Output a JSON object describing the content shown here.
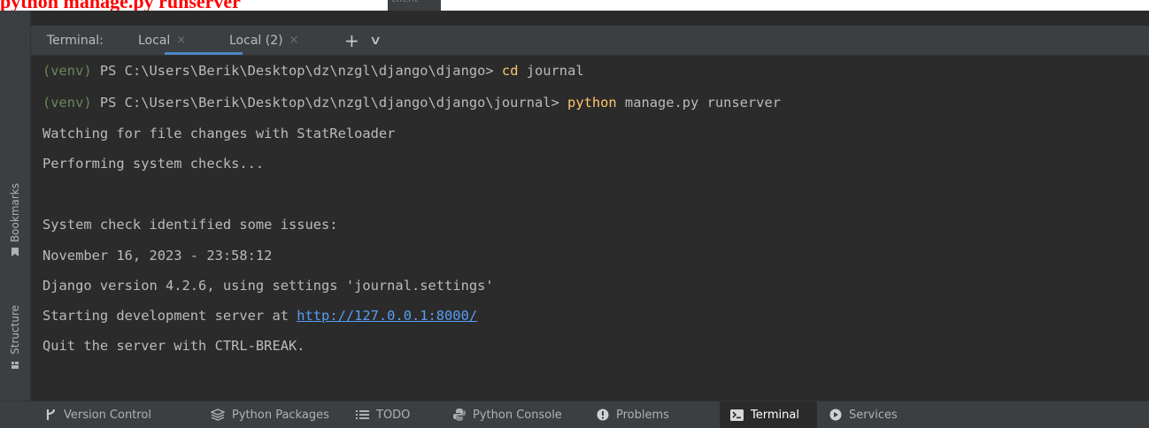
{
  "caption": {
    "text": "python manage.py runserver"
  },
  "top_ghost": {
    "text": "client"
  },
  "left_strip": {
    "bookmarks_label": "Bookmarks",
    "structure_label": "Structure"
  },
  "terminal_header": {
    "title": "Terminal:",
    "tabs": [
      {
        "label": "Local",
        "close": "×"
      },
      {
        "label": "Local (2)",
        "close": "×"
      }
    ],
    "add_symbol": "+",
    "dropdown_symbol": "∨"
  },
  "terminal": {
    "lines": [
      {
        "venv": "(venv)",
        "prompt": " PS C:\\Users\\Berik\\Desktop\\dz\\nzgl\\django\\django> ",
        "cmd": "cd",
        "args": " journal"
      },
      {
        "venv": "(venv)",
        "prompt": " PS C:\\Users\\Berik\\Desktop\\dz\\nzgl\\django\\django\\journal> ",
        "cmd": "python",
        "args": " manage.py runserver"
      },
      {
        "text": "Watching for file changes with StatReloader"
      },
      {
        "text": "Performing system checks..."
      },
      {
        "text": ""
      },
      {
        "text": "System check identified some issues:"
      },
      {
        "text": "November 16, 2023 - 23:58:12"
      },
      {
        "text": "Django version 4.2.6, using settings 'journal.settings'"
      },
      {
        "text": "Starting development server at ",
        "link": "http://127.0.0.1:8000/"
      },
      {
        "text": "Quit the server with CTRL-BREAK."
      }
    ]
  },
  "bottom_bar": {
    "tabs": [
      {
        "label": "Version Control",
        "icon": "version-control-icon"
      },
      {
        "label": "Python Packages",
        "icon": "python-packages-icon"
      },
      {
        "label": "TODO",
        "icon": "todo-icon"
      },
      {
        "label": "Python Console",
        "icon": "python-console-icon"
      },
      {
        "label": "Problems",
        "icon": "problems-icon"
      },
      {
        "label": "Terminal",
        "icon": "terminal-icon",
        "active": true
      },
      {
        "label": "Services",
        "icon": "services-icon"
      }
    ]
  }
}
